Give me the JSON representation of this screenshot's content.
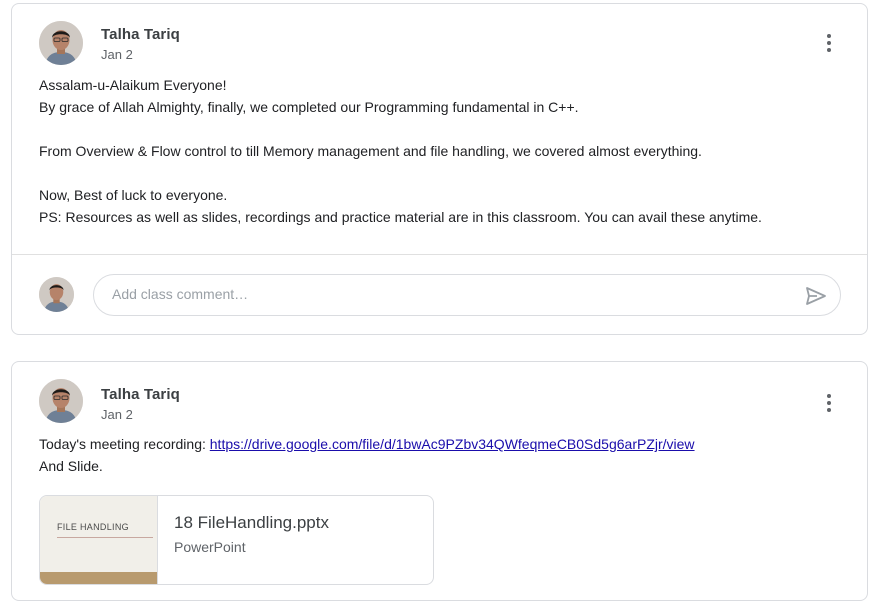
{
  "posts": [
    {
      "author": "Talha Tariq",
      "date": "Jan 2",
      "lines": [
        "Assalam-u-Alaikum Everyone!",
        "By grace of Allah Almighty, finally, we completed our Programming fundamental in C++.",
        "",
        "From Overview & Flow control to till Memory management and file handling, we covered almost everything.",
        "",
        "Now, Best of luck to everyone.",
        "PS: Resources as well as slides, recordings and practice material are in this classroom. You can avail these anytime."
      ],
      "comment_placeholder": "Add class comment…"
    },
    {
      "author": "Talha Tariq",
      "date": "Jan 2",
      "text_prefix": "Today's meeting recording: ",
      "link": "https://drive.google.com/file/d/1bwAc9PZbv34QWfeqmeCB0Sd5g6arPZjr/view",
      "text_line2": "And Slide.",
      "attachment": {
        "thumbnail_title": "FILE HANDLING",
        "name": "18 FileHandling.pptx",
        "type": "PowerPoint"
      }
    }
  ],
  "icons": {
    "menu": "more-vert-icon",
    "send": "send-icon",
    "avatar": "avatar"
  },
  "colors": {
    "link": "#1a0dab",
    "border": "#dadce0",
    "secondary_text": "#5f6368"
  }
}
